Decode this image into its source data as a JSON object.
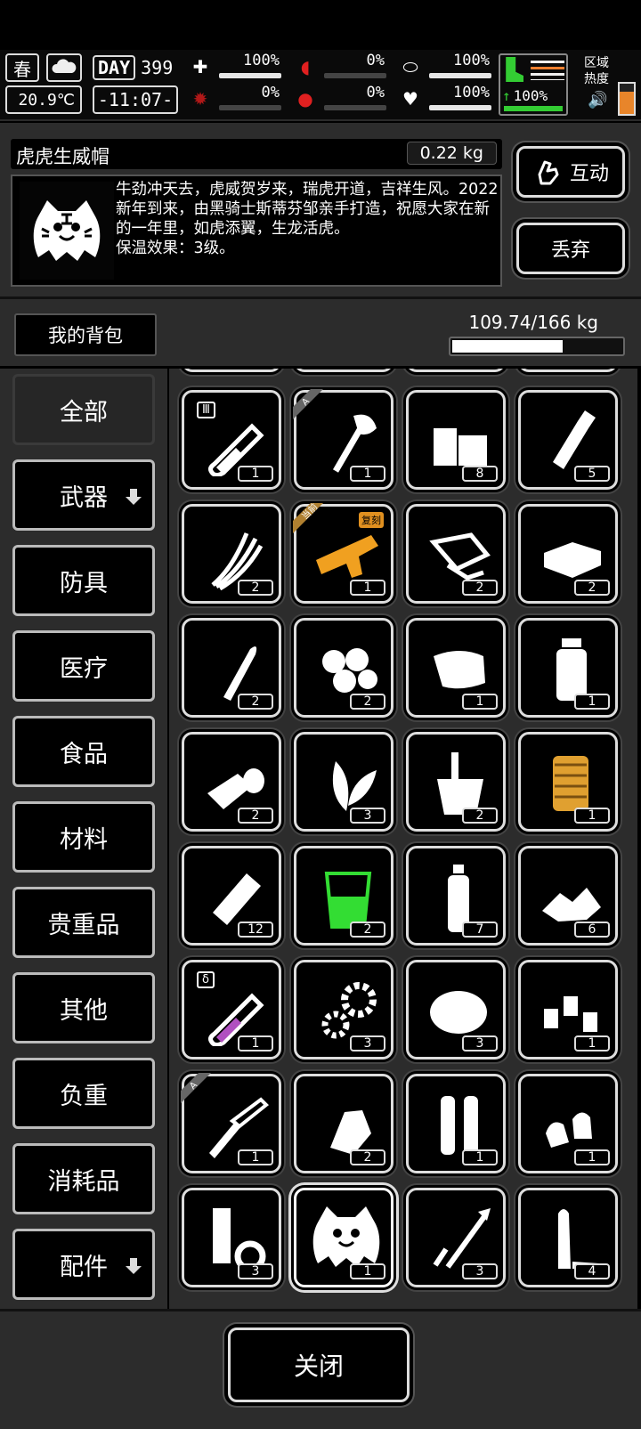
{
  "hud": {
    "season": "春",
    "temperature": "20.9℃",
    "day_tag": "DAY",
    "day": "399",
    "clock": "-11:07-",
    "stats": [
      {
        "icon": "medkit-icon",
        "glyph": "✚",
        "value": "100%",
        "fill": 1.0,
        "color": "#ffffff"
      },
      {
        "icon": "stomach-icon",
        "glyph": "◖",
        "value": "0%",
        "fill": 0.0,
        "color": "#e02020"
      },
      {
        "icon": "pill-icon",
        "glyph": "⬭",
        "value": "100%",
        "fill": 1.0,
        "color": "#ffffff"
      },
      {
        "icon": "virus-icon",
        "glyph": "✹",
        "value": "0%",
        "fill": 0.0,
        "color": "#b01818"
      },
      {
        "icon": "blood-drop-icon",
        "glyph": "●",
        "value": "0%",
        "fill": 0.0,
        "color": "#e02020"
      },
      {
        "icon": "heart-icon",
        "glyph": "♥",
        "value": "100%",
        "fill": 1.0,
        "color": "#ffffff"
      }
    ],
    "stamina": "100%",
    "zone_label_1": "区域",
    "zone_label_2": "热度",
    "zone_heat": 0.75
  },
  "item": {
    "name": "虎虎生威帽",
    "weight": "0.22 kg",
    "description": "牛劲冲天去，虎威贺岁来，瑞虎开道，吉祥生风。2022新年到来，由黑骑士斯蒂芬邹亲手打造，祝愿大家在新的一年里，如虎添翼，生龙活虎。",
    "effect": "保温效果：3级。",
    "interact_label": "互动",
    "drop_label": "丢弃"
  },
  "backpack": {
    "title": "我的背包",
    "weight": "109.74/166 kg",
    "load": 0.661
  },
  "categories": [
    {
      "label": "全部",
      "active": true,
      "dropdown": false
    },
    {
      "label": "武器",
      "active": false,
      "dropdown": true
    },
    {
      "label": "防具",
      "active": false,
      "dropdown": false
    },
    {
      "label": "医疗",
      "active": false,
      "dropdown": false
    },
    {
      "label": "食品",
      "active": false,
      "dropdown": false
    },
    {
      "label": "材料",
      "active": false,
      "dropdown": false
    },
    {
      "label": "贵重品",
      "active": false,
      "dropdown": false
    },
    {
      "label": "其他",
      "active": false,
      "dropdown": false
    },
    {
      "label": "负重",
      "active": false,
      "dropdown": false
    },
    {
      "label": "消耗品",
      "active": false,
      "dropdown": false
    },
    {
      "label": "配件",
      "active": false,
      "dropdown": true
    }
  ],
  "items": [
    {
      "icon": "test-tube-icon",
      "count": "1",
      "tag_letter": "",
      "label_badge": "Ⅲ"
    },
    {
      "icon": "axe-icon",
      "count": "1",
      "tag_letter": "A",
      "label_badge": ""
    },
    {
      "icon": "wood-planks-icon",
      "count": "8",
      "tag_letter": "",
      "label_badge": ""
    },
    {
      "icon": "bottle-icon",
      "count": "5",
      "tag_letter": "",
      "label_badge": ""
    },
    {
      "icon": "wires-icon",
      "count": "2",
      "tag_letter": "",
      "label_badge": ""
    },
    {
      "icon": "golden-gun-icon",
      "count": "1",
      "tag_letter": "当前",
      "label_badge": "复刻"
    },
    {
      "icon": "paper-scraps-icon",
      "count": "2",
      "tag_letter": "",
      "label_badge": ""
    },
    {
      "icon": "cash-bundle-icon",
      "count": "2",
      "tag_letter": "",
      "label_badge": ""
    },
    {
      "icon": "bullet-icon",
      "count": "2",
      "tag_letter": "",
      "label_badge": ""
    },
    {
      "icon": "cotton-balls-icon",
      "count": "2",
      "tag_letter": "",
      "label_badge": ""
    },
    {
      "icon": "cloth-icon",
      "count": "1",
      "tag_letter": "",
      "label_badge": ""
    },
    {
      "icon": "jar-icon",
      "count": "1",
      "tag_letter": "",
      "label_badge": ""
    },
    {
      "icon": "bandage-roll-icon",
      "count": "2",
      "tag_letter": "",
      "label_badge": ""
    },
    {
      "icon": "herb-leaves-icon",
      "count": "3",
      "tag_letter": "",
      "label_badge": ""
    },
    {
      "icon": "bucket-icon",
      "count": "2",
      "tag_letter": "",
      "label_badge": ""
    },
    {
      "icon": "rope-spool-icon",
      "count": "1",
      "tag_letter": "",
      "label_badge": ""
    },
    {
      "icon": "food-bag-icon",
      "count": "12",
      "tag_letter": "",
      "label_badge": ""
    },
    {
      "icon": "green-cup-icon",
      "count": "2",
      "tag_letter": "",
      "label_badge": ""
    },
    {
      "icon": "water-bottle-icon",
      "count": "7",
      "tag_letter": "",
      "label_badge": ""
    },
    {
      "icon": "rubble-icon",
      "count": "6",
      "tag_letter": "",
      "label_badge": ""
    },
    {
      "icon": "purple-vial-icon",
      "count": "1",
      "tag_letter": "",
      "label_badge": "δ"
    },
    {
      "icon": "gears-icon",
      "count": "3",
      "tag_letter": "",
      "label_badge": ""
    },
    {
      "icon": "fur-pile-icon",
      "count": "3",
      "tag_letter": "",
      "label_badge": ""
    },
    {
      "icon": "bottle-caps-icon",
      "count": "1",
      "tag_letter": "",
      "label_badge": ""
    },
    {
      "icon": "caliper-knife-icon",
      "count": "1",
      "tag_letter": "A",
      "label_badge": ""
    },
    {
      "icon": "crumpled-can-icon",
      "count": "2",
      "tag_letter": "",
      "label_badge": ""
    },
    {
      "icon": "shell-casings-icon",
      "count": "1",
      "tag_letter": "",
      "label_badge": ""
    },
    {
      "icon": "bullet-tips-icon",
      "count": "1",
      "tag_letter": "",
      "label_badge": ""
    },
    {
      "icon": "tape-icon",
      "count": "3",
      "tag_letter": "",
      "label_badge": ""
    },
    {
      "icon": "tiger-hat-icon",
      "count": "1",
      "tag_letter": "",
      "label_badge": "",
      "selected": true
    },
    {
      "icon": "dart-tool-icon",
      "count": "3",
      "tag_letter": "",
      "label_badge": ""
    },
    {
      "icon": "rifle-round-icon",
      "count": "4",
      "tag_letter": "",
      "label_badge": ""
    }
  ],
  "close_label": "关闭"
}
